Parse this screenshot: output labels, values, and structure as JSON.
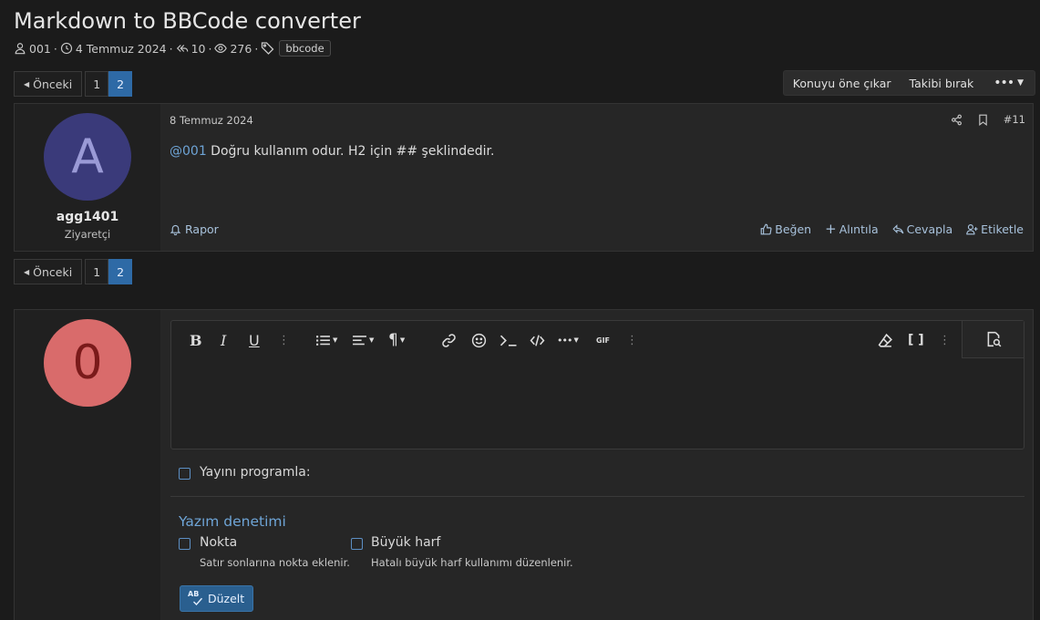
{
  "thread": {
    "title": "Markdown to BBCode converter",
    "author": "001",
    "start_date": "4 Temmuz 2024",
    "replies": "10",
    "views": "276",
    "tag": "bbcode"
  },
  "pagination": {
    "prev_label": "Önceki",
    "pages": [
      "1",
      "2"
    ],
    "current": "2"
  },
  "thread_actions": {
    "feature_label": "Konuyu öne çıkar",
    "unwatch_label": "Takibi bırak"
  },
  "post": {
    "avatar_letter": "A",
    "avatar_bg": "#3a3a7a",
    "avatar_fg": "#9a9ad6",
    "username": "agg1401",
    "user_title": "Ziyaretçi",
    "date": "8 Temmuz 2024",
    "number": "#11",
    "mention": "@001",
    "body_text": " Doğru kullanım odur. H2 için ## şeklindedir.",
    "report_label": "Rapor",
    "like_label": "Beğen",
    "quote_label": "Alıntıla",
    "reply_label": "Cevapla",
    "tag_label": "Etiketle"
  },
  "reply_form": {
    "avatar_letter": "0",
    "avatar_bg": "#d96b6b",
    "avatar_fg": "#7a1a1a",
    "toolbar": {
      "bold": "B",
      "italic": "I",
      "underline": "U",
      "gif": "GIF"
    },
    "schedule_label": "Yayını programla:",
    "spellcheck_title": "Yazım denetimi",
    "dot_label": "Nokta",
    "dot_hint": "Satır sonlarına nokta eklenir.",
    "caps_label": "Büyük harf",
    "caps_hint": "Hatalı büyük harf kullanımı düzenlenir.",
    "fix_label": "Düzelt",
    "fix_icon_text": "AB"
  }
}
